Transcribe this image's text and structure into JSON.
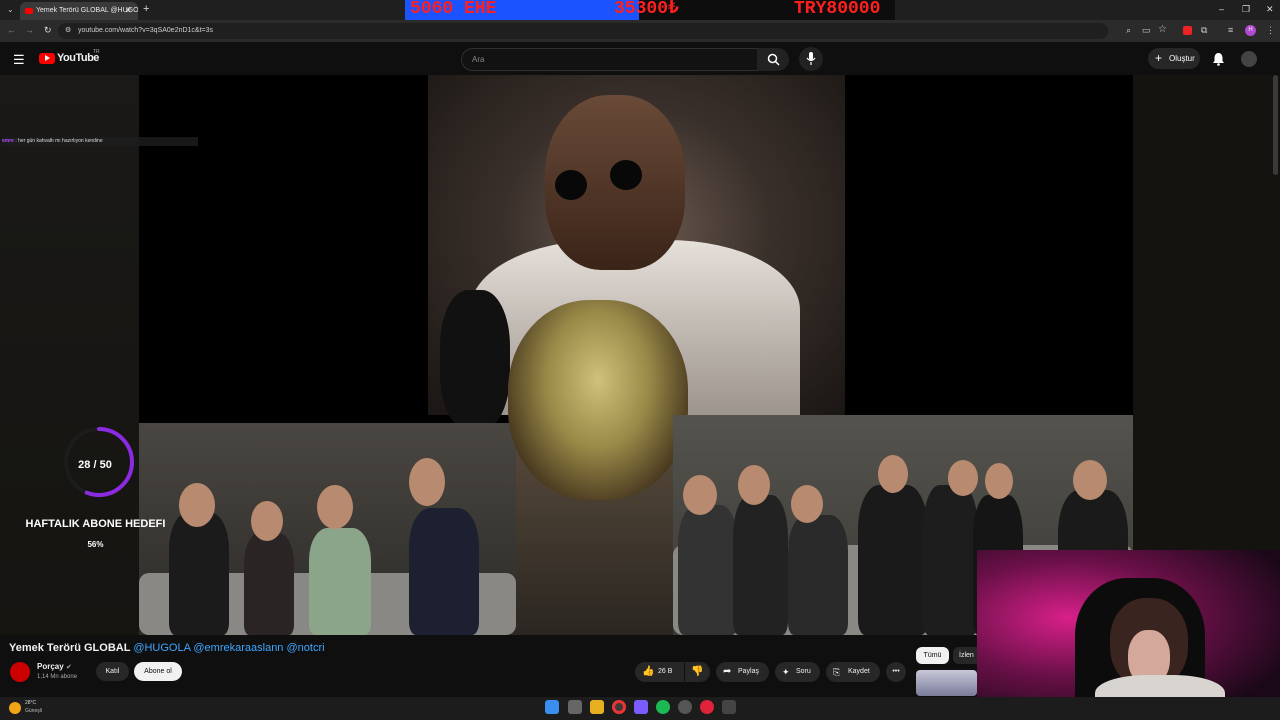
{
  "browser": {
    "tab_title": "Yemek Terörü GLOBAL @HUGO...",
    "url": "youtube.com/watch?v=3qSA0e2nD1c&t=3s"
  },
  "overlay_banner": {
    "left_text": "5060 EHE",
    "mid_text": "35300₺",
    "right_text": "TRY80000"
  },
  "youtube": {
    "logo_text": "YouTube",
    "logo_sup": "TR",
    "search_placeholder": "Ara",
    "create_label": "Oluştur"
  },
  "stream_overlay": {
    "chat_user": "emre",
    "chat_message": "her gün kahvaltı mı hazırlıyon kendine",
    "goal_counter": "28 / 50",
    "goal_title": "HAFTALIK ABONE HEDEFI",
    "goal_percent": "56%",
    "goal_progress": 0.56
  },
  "video": {
    "title_main": "Yemek Terörü GLOBAL",
    "title_links": "@HUGOLA @emrekaraaslann @notcri",
    "channel_name": "Porçay",
    "channel_subs": "1,14 Mn abone",
    "join_label": "Katıl",
    "subscribe_label": "Abone ol",
    "likes": "26 B",
    "share_label": "Paylaş",
    "ask_label": "Soru",
    "save_label": "Kaydet"
  },
  "sidebar_chips": {
    "all_label": "Tümü",
    "watched_label": "İzlen"
  },
  "taskbar": {
    "temperature": "28°C",
    "weather": "Güneşli"
  },
  "colors": {
    "accent_red": "#ff0000",
    "link_blue": "#3ea6ff",
    "goal_ring": "#8a2be2",
    "banner_blue": "#1a53ff",
    "banner_text": "#ff1f1f"
  }
}
